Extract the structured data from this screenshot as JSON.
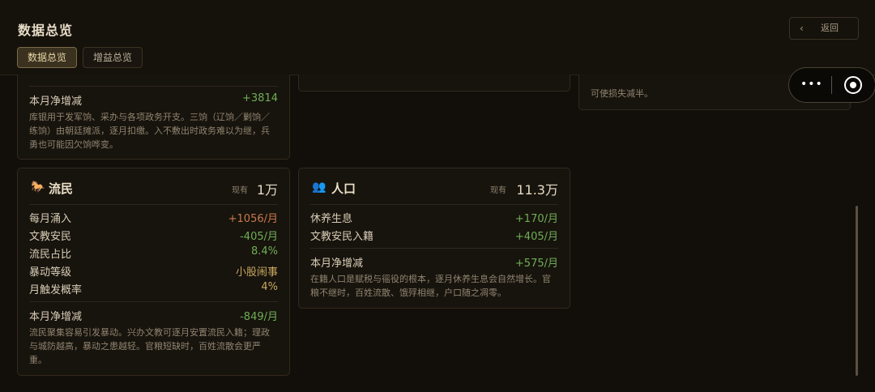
{
  "header": {
    "title": "数据总览",
    "tabs": [
      {
        "label": "数据总览",
        "active": true
      },
      {
        "label": "增益总览",
        "active": false
      }
    ],
    "back_label": "返回"
  },
  "capsule": {
    "more_icon": "•••",
    "target_icon": "record-icon"
  },
  "treasury_card": {
    "net_label": "本月净增减",
    "net_value": "+3814",
    "desc": "库银用于发军饷、采办与各项政务开支。三饷（辽饷／剿饷／练饷）由朝廷摊派，逐月扣缴。入不敷出时政务难以为继，兵勇也可能因欠饷哗变。"
  },
  "right_card_top": {
    "desc_tail": "可使损失减半。"
  },
  "refugee_card": {
    "icon": "🐎",
    "title": "流民",
    "have_label": "现有",
    "amount": "1万",
    "rows": [
      {
        "label": "每月涌入",
        "value": "+1056/月"
      },
      {
        "label": "文教安民",
        "value": "-405/月"
      },
      {
        "label": "流民占比",
        "value": "8.4%"
      },
      {
        "label": "暴动等级",
        "value": "小股闹事"
      },
      {
        "label": "月触发概率",
        "value": "4%"
      }
    ],
    "net_label": "本月净增减",
    "net_value": "-849/月",
    "desc": "流民聚集容易引发暴动。兴办文教可逐月安置流民入籍；理政与城防越高，暴动之患越轻。官粮短缺时，百姓流散会更严重。"
  },
  "population_card": {
    "icon": "👥",
    "title": "人口",
    "have_label": "现有",
    "amount": "11.3万",
    "rows": [
      {
        "label": "休养生息",
        "value": "+170/月"
      },
      {
        "label": "文教安民入籍",
        "value": "+405/月"
      }
    ],
    "net_label": "本月净增减",
    "net_value": "+575/月",
    "desc": "在籍人口是赋税与徭役的根本，逐月休养生息会自然增长。官粮不继时，百姓流散、饿殍相继，户口随之凋零。"
  }
}
